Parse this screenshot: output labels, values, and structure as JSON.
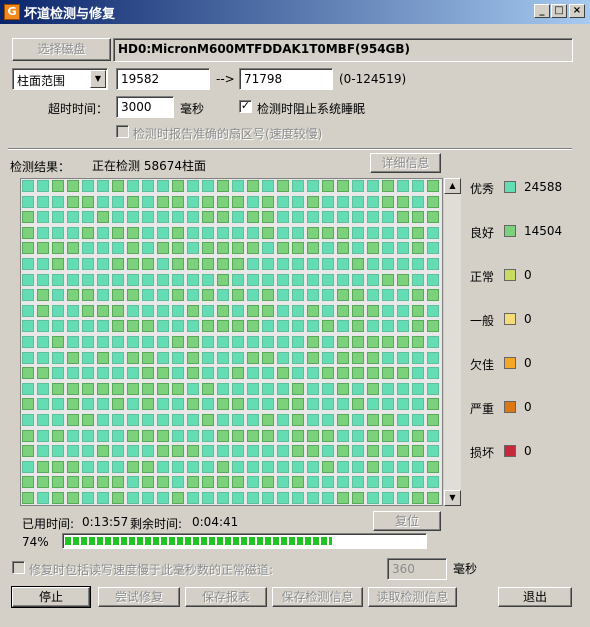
{
  "window": {
    "title": "坏道检测与修复",
    "app_icon": "repair-app-icon",
    "min_label": "_",
    "max_label": "□",
    "close_label": "×"
  },
  "disk": {
    "select_button": "选择磁盘",
    "name": "HD0:MicronM600MTFDDAK1T0MBF(954GB)"
  },
  "range": {
    "mode": "柱面范围",
    "start": "19582",
    "arrow": "-->",
    "end": "71798",
    "hint": "(0-124519)"
  },
  "timeout": {
    "label": "超时时间：",
    "value": "3000",
    "unit": "毫秒"
  },
  "options": {
    "prevent_sleep": "检测时阻止系统睡眠",
    "prevent_sleep_checked": true,
    "report_sector": "检测时报告准确的扇区号(速度较慢)",
    "report_sector_checked": false
  },
  "result": {
    "label": "检测结果：",
    "status": "正在检测 58674柱面",
    "details_button": "详细信息"
  },
  "grid": {
    "cols": 28,
    "rows": 21
  },
  "legend": [
    {
      "label": "优秀",
      "color": "#64dcb4",
      "count": "24588"
    },
    {
      "label": "良好",
      "color": "#7cd27c",
      "count": "14504"
    },
    {
      "label": "正常",
      "color": "#c8dc64",
      "count": "0"
    },
    {
      "label": "一般",
      "color": "#f5dc78",
      "count": "0"
    },
    {
      "label": "欠佳",
      "color": "#f5a828",
      "count": "0"
    },
    {
      "label": "严重",
      "color": "#dc7814",
      "count": "0"
    },
    {
      "label": "损坏",
      "color": "#c8283c",
      "count": "0"
    }
  ],
  "timing": {
    "elapsed_label": "已用时间:",
    "elapsed": "0:13:57",
    "remaining_label": "剩余时间:",
    "remaining": "0:04:41",
    "reset_button": "复位"
  },
  "progress": {
    "text": "74%",
    "value": 0.74
  },
  "repair": {
    "include_slow_label": "修复时包括读写速度慢于此毫秒数的正常磁道:",
    "include_slow_checked": false,
    "threshold": "360",
    "unit": "毫秒"
  },
  "buttons": {
    "stop": "停止",
    "try_repair": "尝试修复",
    "save_report": "保存报表",
    "save_info": "保存检测信息",
    "load_info": "读取检测信息",
    "exit": "退出"
  }
}
